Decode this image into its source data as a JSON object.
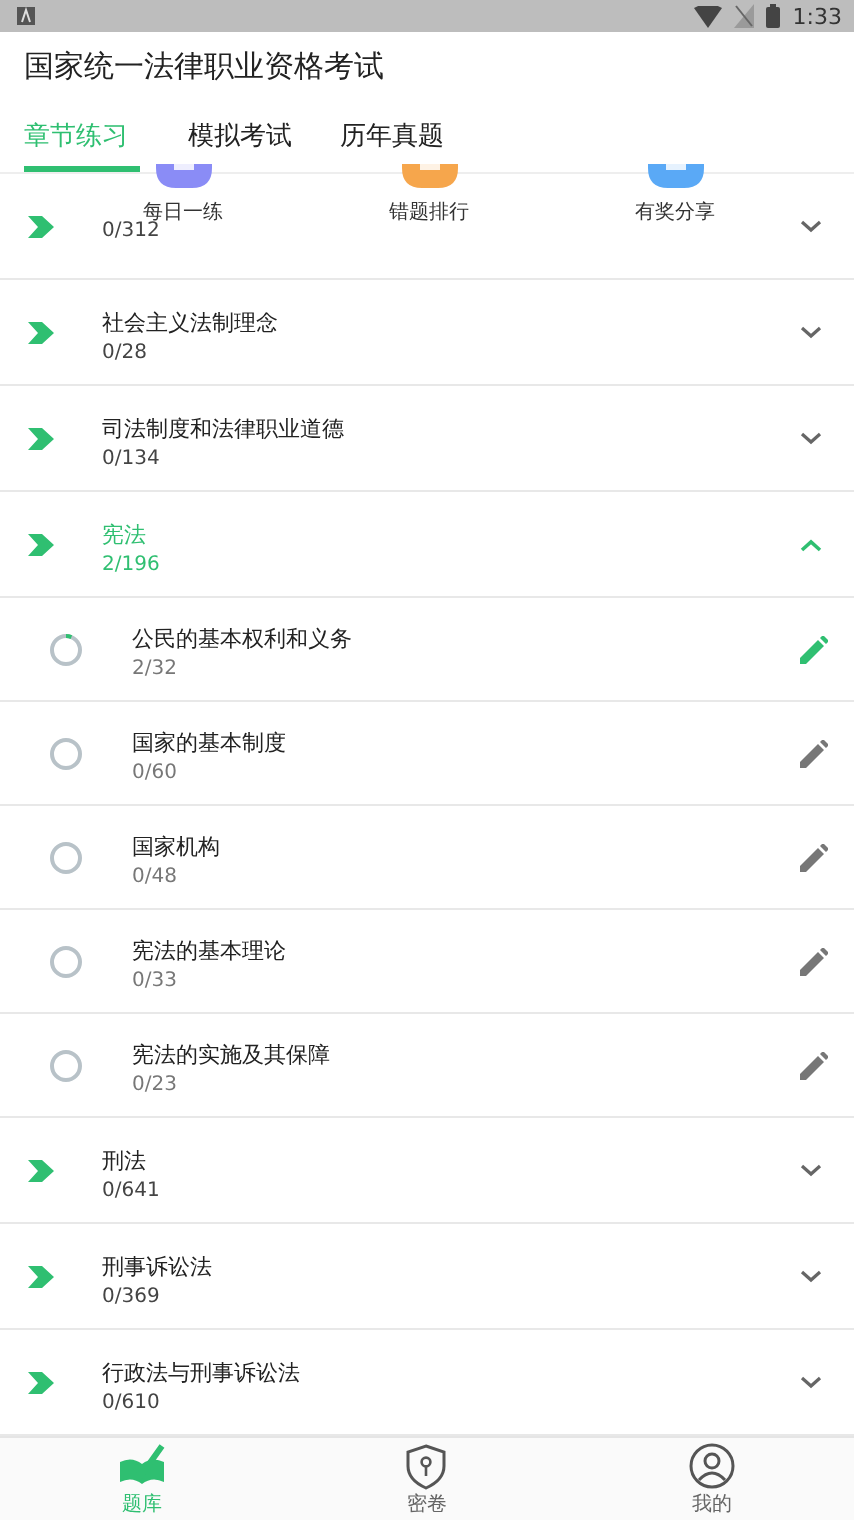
{
  "status_bar": {
    "time": "1:33"
  },
  "app_bar": {
    "title": "国家统一法律职业资格考试"
  },
  "tabs": [
    {
      "label": "章节练习",
      "selected": true
    },
    {
      "label": "模拟考试",
      "selected": false
    },
    {
      "label": "历年真题",
      "selected": false
    }
  ],
  "quick_actions": [
    {
      "label": "每日一练",
      "color": "#8a8cf6"
    },
    {
      "label": "错题排行",
      "color": "#f6a64c"
    },
    {
      "label": "有奖分享",
      "color": "#5aa9f6"
    }
  ],
  "chapters": [
    {
      "count": "0/312",
      "expanded": false
    },
    {
      "title": "社会主义法制理念",
      "count": "0/28",
      "expanded": false
    },
    {
      "title": "司法制度和法律职业道德",
      "count": "0/134",
      "expanded": false
    },
    {
      "title": "宪法",
      "count": "2/196",
      "expanded": true,
      "children": [
        {
          "title": "公民的基本权利和义务",
          "count": "2/32",
          "level": 0.0625
        },
        {
          "title": "国家的基本制度",
          "count": "0/60",
          "level": 0
        },
        {
          "title": "国家机构",
          "count": "0/48",
          "level": 0
        },
        {
          "title": "宪法的基本理论",
          "count": "0/33",
          "level": 0
        },
        {
          "title": "宪法的实施及其保障",
          "count": "0/23",
          "level": 0
        }
      ]
    },
    {
      "title": "刑法",
      "count": "0/641",
      "expanded": false
    },
    {
      "title": "刑事诉讼法",
      "count": "0/369",
      "expanded": false
    },
    {
      "title": "行政法与刑事诉讼法",
      "count": "0/610",
      "expanded": false
    }
  ],
  "bottom_nav": [
    {
      "label": "题库",
      "kind": "book",
      "selected": true
    },
    {
      "label": "密卷",
      "kind": "shield",
      "selected": false
    },
    {
      "label": "我的",
      "kind": "person",
      "selected": false
    }
  ]
}
